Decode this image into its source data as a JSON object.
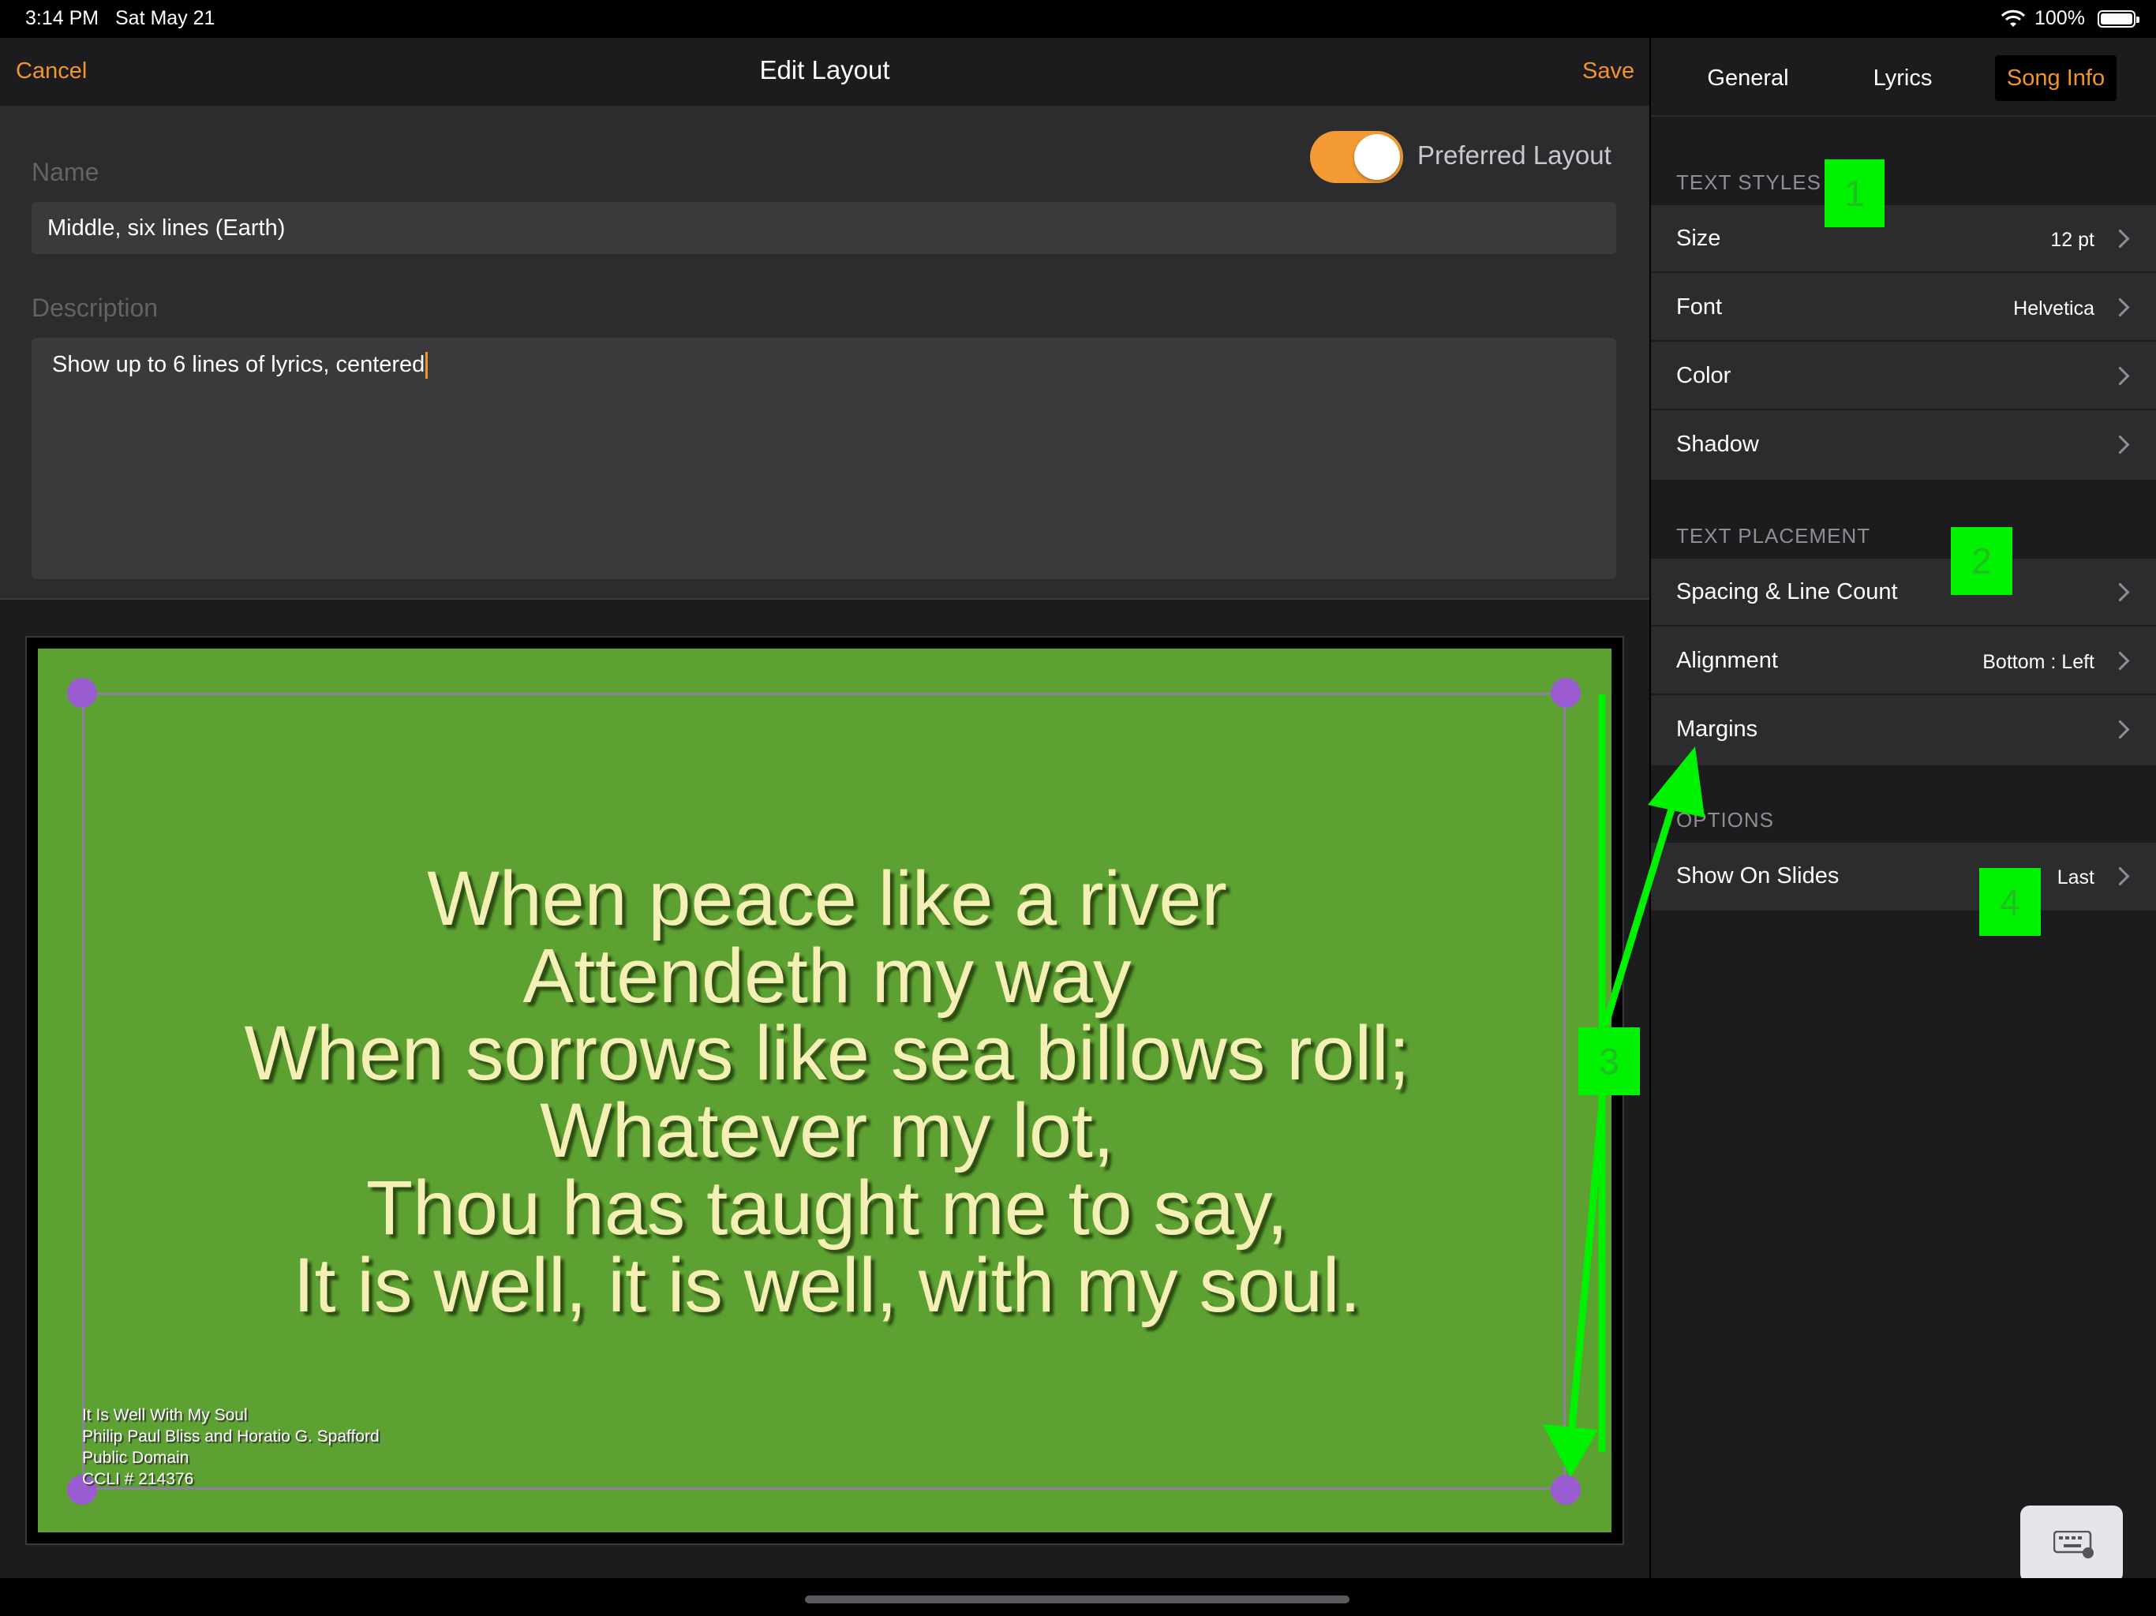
{
  "status_bar": {
    "time": "3:14 PM",
    "date": "Sat May 21",
    "battery_text": "100%",
    "wifi_icon": "wifi-icon",
    "battery_icon": "battery-full-icon"
  },
  "nav": {
    "cancel": "Cancel",
    "title": "Edit Layout",
    "save": "Save"
  },
  "form": {
    "name_label": "Name",
    "name_value": "Middle, six lines (Earth)",
    "description_label": "Description",
    "description_value": "Show up to 6 lines of lyrics, centered",
    "preferred_label": "Preferred Layout",
    "preferred_on": true
  },
  "preview": {
    "background_color": "#5da132",
    "lyric_color": "#f4f0b5",
    "lyrics": [
      "When peace like a river",
      "Attendeth my way",
      "When sorrows like sea billows roll;",
      "Whatever my lot,",
      "Thou has taught me to say,",
      "It is well, it is well, with my soul."
    ],
    "credits": [
      "It Is Well With My Soul",
      "Philip Paul Bliss and Horatio G. Spafford",
      "Public Domain",
      "CCLI # 214376"
    ]
  },
  "tabs": [
    {
      "label": "General",
      "selected": false
    },
    {
      "label": "Lyrics",
      "selected": false
    },
    {
      "label": "Song Info",
      "selected": true
    }
  ],
  "text_styles": {
    "header": "TEXT STYLES",
    "rows": [
      {
        "label": "Size",
        "value": "12 pt"
      },
      {
        "label": "Font",
        "value": "Helvetica"
      },
      {
        "label": "Color",
        "value": ""
      },
      {
        "label": "Shadow",
        "value": ""
      }
    ]
  },
  "text_placement": {
    "header": "TEXT PLACEMENT",
    "rows": [
      {
        "label": "Spacing & Line Count",
        "value": ""
      },
      {
        "label": "Alignment",
        "value": "Bottom : Left"
      },
      {
        "label": "Margins",
        "value": ""
      }
    ]
  },
  "options": {
    "header": "OPTIONS",
    "rows": [
      {
        "label": "Show On Slides",
        "value": "Last"
      }
    ]
  },
  "annotations": [
    "1",
    "2",
    "3",
    "4"
  ],
  "colors": {
    "accent": "#f0942c",
    "annotation": "#00f200",
    "handle": "#9b5cd1"
  }
}
